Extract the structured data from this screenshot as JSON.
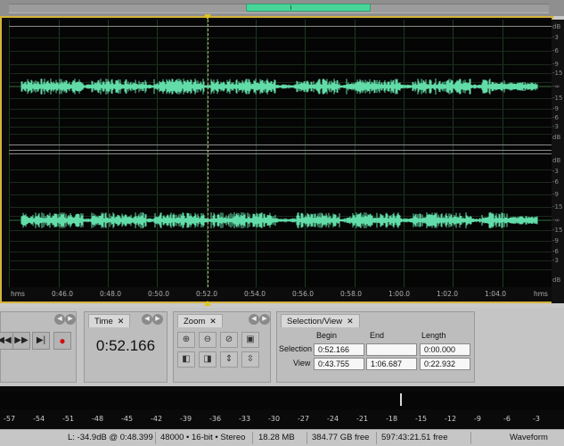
{
  "colors": {
    "waveform": "#62dca8",
    "cursor": "#e0c61a",
    "frame": "#d4b33a"
  },
  "ruler_right": {
    "top_labels": [
      "dB",
      "-3",
      "-6",
      "-9",
      "-15",
      "-∞",
      "-15",
      "-9",
      "-6",
      "-3",
      "dB"
    ],
    "bottom_labels": [
      "dB",
      "-3",
      "-6",
      "-9",
      "-15",
      "-∞",
      "-15",
      "-9",
      "-6",
      "-3",
      "dB"
    ]
  },
  "time_ruler": {
    "start_label": "hms",
    "end_label": "hms",
    "ticks": [
      "0:46.0",
      "0:48.0",
      "0:50.0",
      "0:52.0",
      "0:54.0",
      "0:56.0",
      "0:58.0",
      "1:00.0",
      "1:02.0",
      "1:04.0"
    ]
  },
  "transport": {
    "buttons": [
      "rewind-icon",
      "fast-forward-icon",
      "go-to-end-icon",
      "record-icon"
    ]
  },
  "time_panel": {
    "tab": "Time",
    "value": "0:52.166"
  },
  "zoom_panel": {
    "tab": "Zoom"
  },
  "selection_panel": {
    "tab": "Selection/View",
    "headers": {
      "begin": "Begin",
      "end": "End",
      "length": "Length"
    },
    "rows": [
      {
        "label": "Selection",
        "begin": "0:52.166",
        "end": "",
        "length": "0:00.000"
      },
      {
        "label": "View",
        "begin": "0:43.755",
        "end": "1:06.687",
        "length": "0:22.932"
      }
    ]
  },
  "meter": {
    "scale": [
      "-57",
      "-54",
      "-51",
      "-48",
      "-45",
      "-42",
      "-39",
      "-36",
      "-33",
      "-30",
      "-27",
      "-24",
      "-21",
      "-18",
      "-15",
      "-12",
      "-9",
      "-6",
      "-3"
    ]
  },
  "status": {
    "level": "L: -34.9dB @  0:48.399",
    "format": "48000 • 16-bit • Stereo",
    "size": "18.28 MB",
    "free_space": "384.77 GB free",
    "free_time": "597:43:21.51 free",
    "view_mode": "Waveform"
  }
}
